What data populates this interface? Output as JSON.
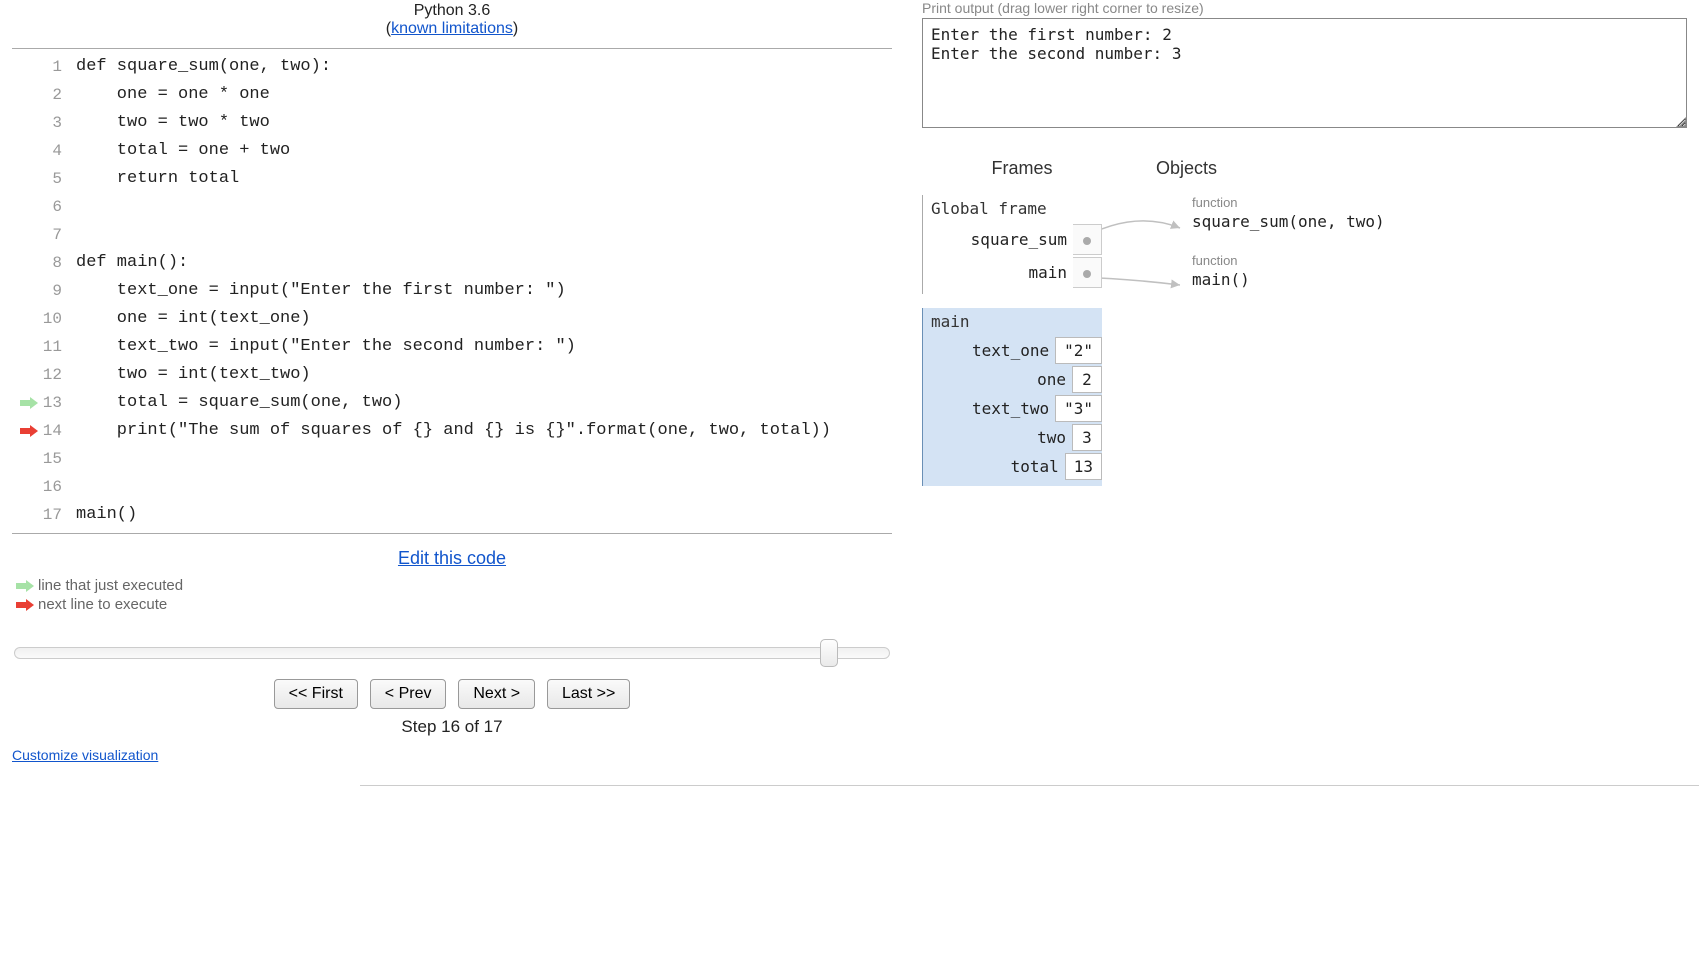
{
  "header": {
    "lang": "Python 3.6",
    "limitations_label": "known limitations"
  },
  "code": {
    "lines": [
      "def square_sum(one, two):",
      "    one = one * one",
      "    two = two * two",
      "    total = one + two",
      "    return total",
      "",
      "",
      "def main():",
      "    text_one = input(\"Enter the first number: \")",
      "    one = int(text_one)",
      "    text_two = input(\"Enter the second number: \")",
      "    two = int(text_two)",
      "    total = square_sum(one, two)",
      "    print(\"The sum of squares of {} and {} is {}\".format(one, two, total))",
      "",
      "",
      "main()"
    ],
    "just_executed_line": 13,
    "next_line": 14
  },
  "edit_link_label": "Edit this code",
  "legend": {
    "just_executed": "line that just executed",
    "next_line": "next line to execute"
  },
  "slider": {
    "value": 16,
    "max": 17
  },
  "nav": {
    "first": "<< First",
    "prev": "< Prev",
    "next": "Next >",
    "last": "Last >>"
  },
  "step_label": "Step 16 of 17",
  "customize_label": "Customize visualization",
  "output": {
    "label": "Print output (drag lower right corner to resize)",
    "text": "Enter the first number: 2\nEnter the second number: 3"
  },
  "viz_headers": {
    "frames": "Frames",
    "objects": "Objects"
  },
  "frames": {
    "global": {
      "title": "Global frame",
      "vars": [
        {
          "name": "square_sum",
          "pointer": true
        },
        {
          "name": "main",
          "pointer": true
        }
      ]
    },
    "active": {
      "title": "main",
      "vars": [
        {
          "name": "text_one",
          "value": "\"2\""
        },
        {
          "name": "one",
          "value": "2"
        },
        {
          "name": "text_two",
          "value": "\"3\""
        },
        {
          "name": "two",
          "value": "3"
        },
        {
          "name": "total",
          "value": "13"
        }
      ]
    }
  },
  "objects": [
    {
      "type_label": "function",
      "repr": "square_sum(one, two)"
    },
    {
      "type_label": "function",
      "repr": "main()"
    }
  ]
}
